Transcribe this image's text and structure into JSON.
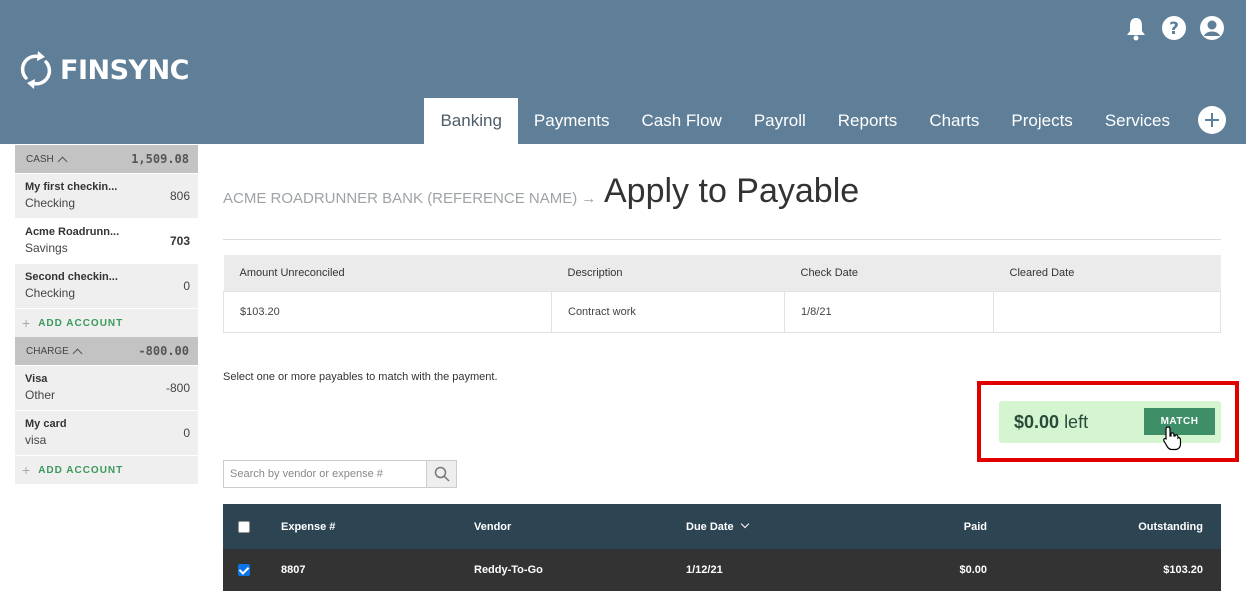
{
  "app": {
    "logo_text": "FINSYNC"
  },
  "nav": {
    "items": [
      "Banking",
      "Payments",
      "Cash Flow",
      "Payroll",
      "Reports",
      "Charts",
      "Projects",
      "Services"
    ]
  },
  "sidebar": {
    "cash": {
      "title": "CASH",
      "total": "1,509.08",
      "accounts": [
        {
          "name": "My first checkin...",
          "type": "Checking",
          "amount": "806"
        },
        {
          "name": "Acme Roadrunn...",
          "type": "Savings",
          "amount": "703"
        },
        {
          "name": "Second checkin...",
          "type": "Checking",
          "amount": "0"
        }
      ],
      "add_label": "ADD ACCOUNT"
    },
    "charge": {
      "title": "CHARGE",
      "total": "-800.00",
      "accounts": [
        {
          "name": "Visa",
          "type": "Other",
          "amount": "-800"
        },
        {
          "name": "My card",
          "type": "visa",
          "amount": "0"
        }
      ],
      "add_label": "ADD ACCOUNT"
    }
  },
  "main": {
    "breadcrumb": "ACME ROADRUNNER BANK (REFERENCE NAME)",
    "breadcrumb_arrow": "→",
    "title": "Apply to Payable",
    "info_table": {
      "headers": [
        "Amount Unreconciled",
        "Description",
        "Check Date",
        "Cleared Date"
      ],
      "row": [
        "$103.20",
        "Contract work",
        "1/8/21",
        ""
      ]
    },
    "instructions": "Select one or more payables to match with the payment.",
    "remaining": {
      "amount": "$0.00",
      "suffix": "left",
      "button_label": "MATCH"
    },
    "search": {
      "placeholder": "Search by vendor or expense #"
    },
    "expense_table": {
      "headers": {
        "expense": "Expense #",
        "vendor": "Vendor",
        "due_date": "Due Date",
        "paid": "Paid",
        "outstanding": "Outstanding"
      },
      "rows": [
        {
          "expense": "8807",
          "vendor": "Reddy-To-Go",
          "due_date": "1/12/21",
          "paid": "$0.00",
          "outstanding": "$103.20",
          "checked": true
        }
      ]
    }
  },
  "colors": {
    "header_bg": "#5f7e97",
    "accent_green": "#3e8e67",
    "match_bg": "#d4f5d0",
    "highlight_red": "#e10000",
    "table_head": "#2d4453"
  }
}
